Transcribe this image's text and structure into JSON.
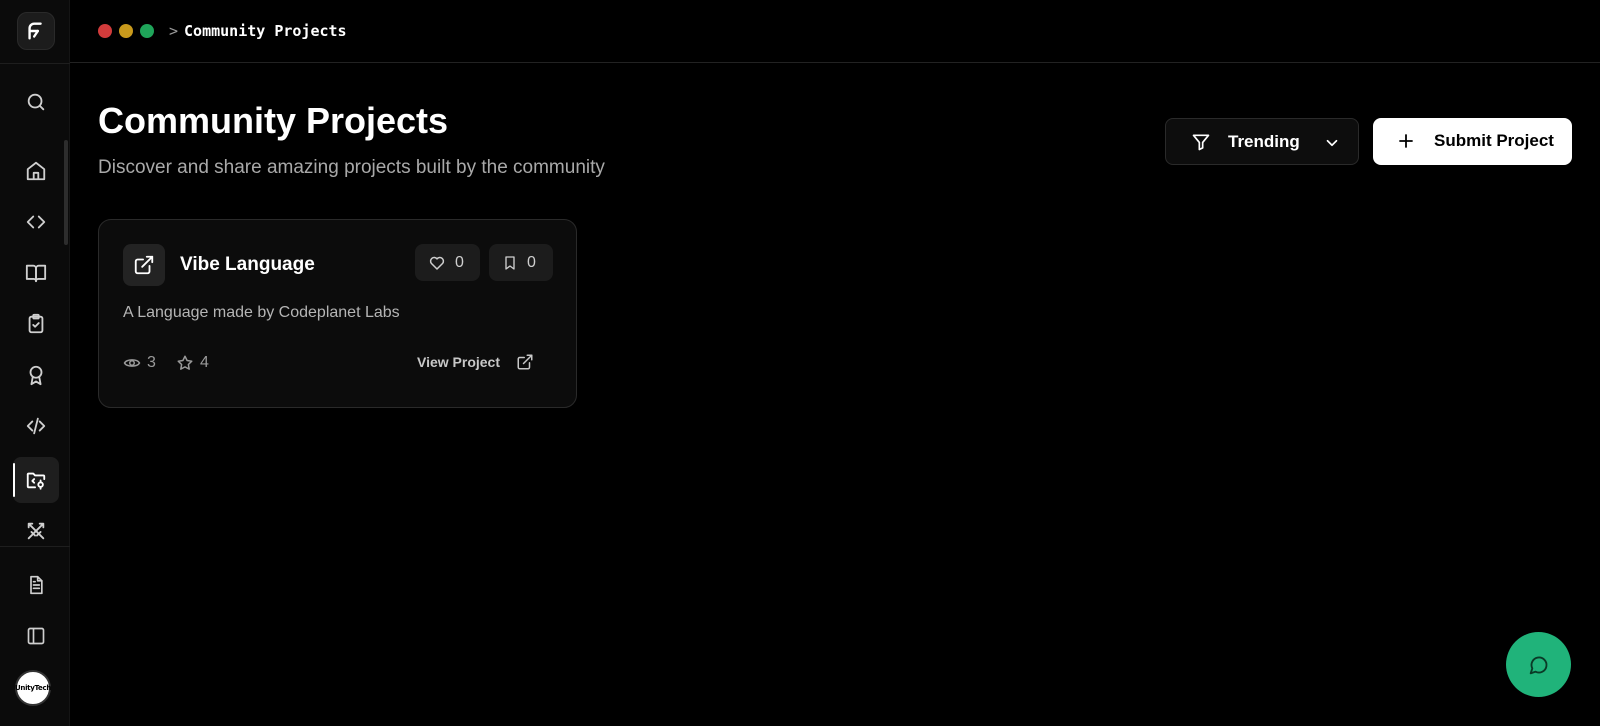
{
  "breadcrumb": {
    "separator": ">",
    "current": "Community Projects"
  },
  "sidebar": {
    "logo": "logo-icon",
    "items": [
      {
        "icon": "search-icon"
      },
      {
        "icon": "home-icon"
      },
      {
        "icon": "code-icon"
      },
      {
        "icon": "book-icon"
      },
      {
        "icon": "clipboard-check-icon"
      },
      {
        "icon": "award-icon"
      },
      {
        "icon": "code-slash-icon"
      },
      {
        "icon": "folder-code-icon",
        "active": true
      },
      {
        "icon": "swords-icon"
      }
    ],
    "bottom_items": [
      {
        "icon": "file-text-icon"
      },
      {
        "icon": "panel-left-icon"
      }
    ],
    "avatar_text": "UnityTech"
  },
  "header": {
    "title": "Community Projects",
    "subtitle": "Discover and share amazing projects built by the community"
  },
  "sort": {
    "label": "Trending"
  },
  "submit": {
    "label": "Submit Project"
  },
  "projects": [
    {
      "title": "Vibe Language",
      "likes": "0",
      "bookmarks": "0",
      "description": "A Language made by Codeplanet Labs",
      "views": "3",
      "stars": "4",
      "link_label": "View Project"
    }
  ],
  "colors": {
    "background": "#000000",
    "accent": "#20b37a",
    "dot_red": "#d13b3b",
    "dot_yellow": "#c99a1c",
    "dot_green": "#1fa55a"
  }
}
